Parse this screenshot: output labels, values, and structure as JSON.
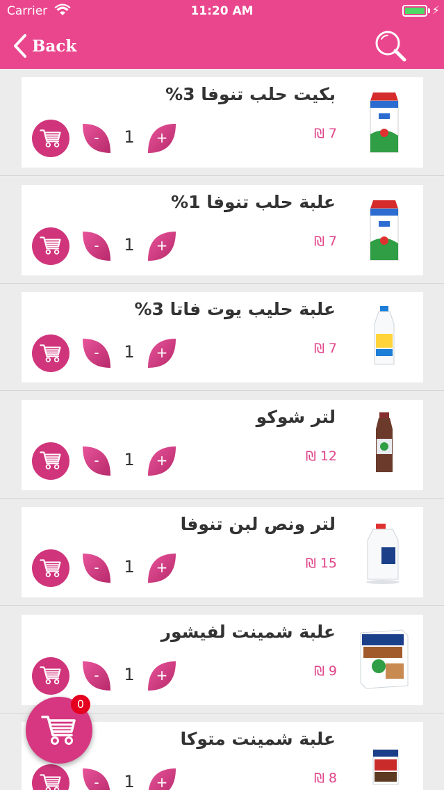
{
  "status_bar": {
    "carrier": "Carrier",
    "time": "11:20 AM",
    "battery_level": 1.0
  },
  "nav": {
    "back_label": "Back"
  },
  "colors": {
    "brand": "#ea468d",
    "accent": "#d0357c",
    "price": "#e0458a"
  },
  "products": [
    {
      "name": "بكيت حلب تنوفا 3%",
      "price": "7 ₪",
      "quantity": "1",
      "image": "milk-carton"
    },
    {
      "name": "علبة حلب تنوفا 1%",
      "price": "7 ₪",
      "quantity": "1",
      "image": "milk-carton"
    },
    {
      "name": "علبة حليب يوت فاتا 3%",
      "price": "7 ₪",
      "quantity": "1",
      "image": "milk-bottle"
    },
    {
      "name": "لتر شوكو",
      "price": "12 ₪",
      "quantity": "1",
      "image": "chocolate-milk-bottle"
    },
    {
      "name": "لتر ونص لبن تنوفا",
      "price": "15 ₪",
      "quantity": "1",
      "image": "leben-jug"
    },
    {
      "name": "علبة شمينت لفيشور",
      "price": "9 ₪",
      "quantity": "1",
      "image": "cream-carton"
    },
    {
      "name": "علبة شمينت متوكا",
      "price": "8 ₪",
      "quantity": "1",
      "image": "cream-carton-small"
    }
  ],
  "cart": {
    "count": "0"
  }
}
